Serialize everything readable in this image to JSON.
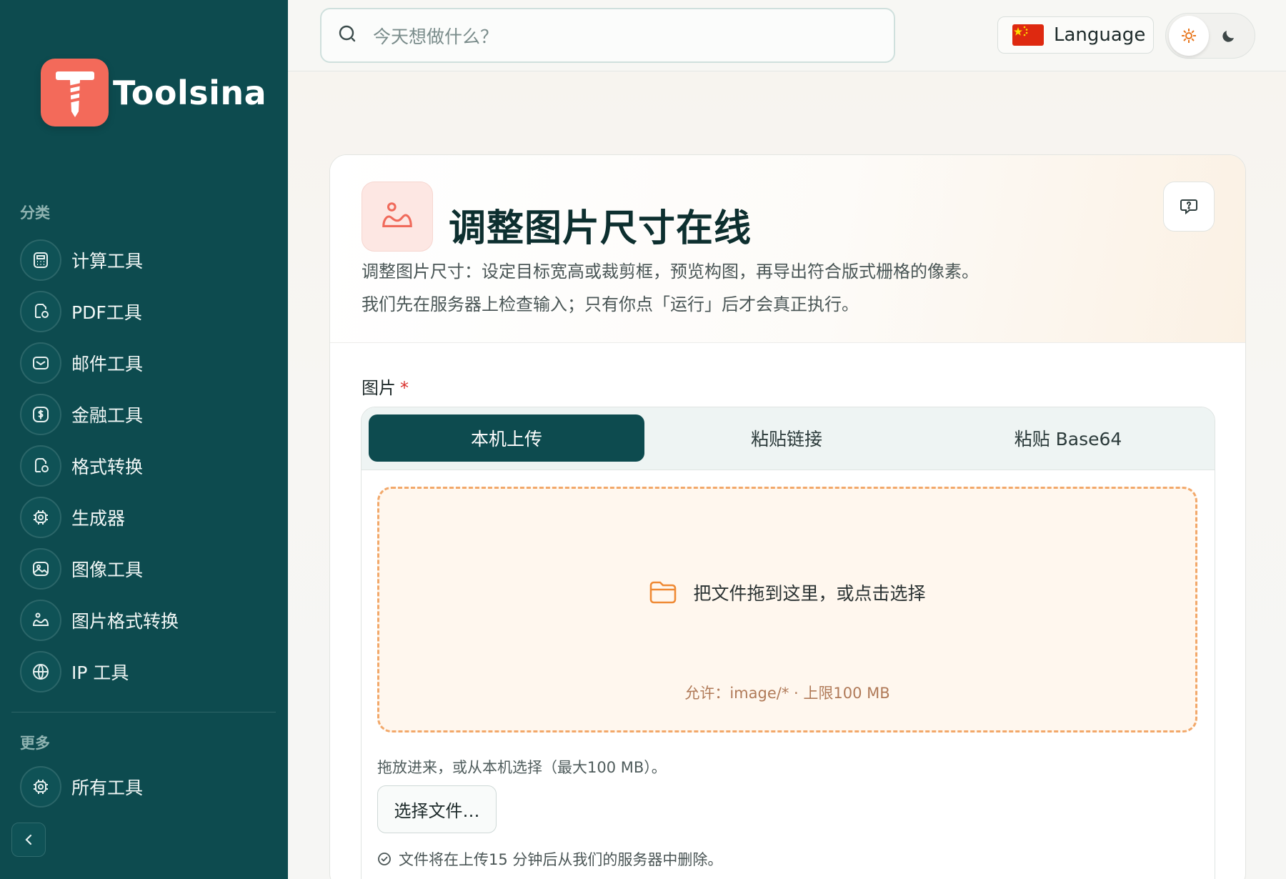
{
  "brand": {
    "name": "Toolsina"
  },
  "sidebar": {
    "categories_label": "分类",
    "items": [
      {
        "label": "计算工具",
        "icon": "calculator-icon"
      },
      {
        "label": "PDF工具",
        "icon": "document-icon"
      },
      {
        "label": "邮件工具",
        "icon": "mail-icon"
      },
      {
        "label": "金融工具",
        "icon": "dollar-icon"
      },
      {
        "label": "格式转换",
        "icon": "convert-icon"
      },
      {
        "label": "生成器",
        "icon": "chip-icon"
      },
      {
        "label": "图像工具",
        "icon": "image-icon"
      },
      {
        "label": "图片格式转换",
        "icon": "photo-convert-icon"
      },
      {
        "label": "IP 工具",
        "icon": "globe-icon"
      }
    ],
    "more_label": "更多",
    "more_items": [
      {
        "label": "所有工具",
        "icon": "chip-icon"
      }
    ]
  },
  "topbar": {
    "search_placeholder": "今天想做什么？",
    "language_label": "Language"
  },
  "tool": {
    "title": "调整图片尺寸在线",
    "description_1": "调整图片尺寸：设定目标宽高或裁剪框，预览构图，再导出符合版式栅格的像素。",
    "description_2": "我们先在服务器上检查输入；只有你点「运行」后才会真正执行。"
  },
  "form": {
    "field_label": "图片",
    "required_mark": "*",
    "tabs": [
      {
        "label": "本机上传",
        "active": true
      },
      {
        "label": "粘贴链接",
        "active": false
      },
      {
        "label": "粘贴 Base64",
        "active": false
      }
    ],
    "dropzone_text": "把文件拖到这里，或点击选择",
    "dropzone_hint": "允许：image/* · 上限100 MB",
    "help_text": "拖放进来，或从本机选择（最大100 MB）。",
    "choose_file_label": "选择文件…",
    "notice": "文件将在上传15 分钟后从我们的服务器中删除。"
  },
  "colors": {
    "sidebar_bg": "#0d4b4f",
    "brand_accent": "#f36a5a",
    "dropzone_border": "#f2a86a",
    "active_tab_bg": "#0d4b4f"
  }
}
